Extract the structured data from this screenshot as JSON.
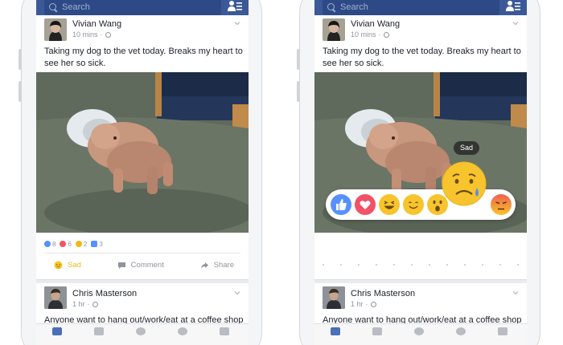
{
  "colors": {
    "facebook_blue": "#3b5998",
    "like_blue": "#5890ff",
    "love_red": "#f25268",
    "sad_yellow": "#f0ba15",
    "angry_orange": "#f0624d"
  },
  "search": {
    "placeholder": "Search"
  },
  "post": {
    "author": "Vivian Wang",
    "time": "10 mins",
    "separator": "·",
    "text": "Taking my dog to the vet today. Breaks my heart to see her so sick."
  },
  "reactions_summary": [
    {
      "icon": "like-icon",
      "count": "8"
    },
    {
      "icon": "love-icon",
      "count": "6"
    },
    {
      "icon": "sad-icon",
      "count": "2"
    },
    {
      "icon": "comment-icon",
      "count": "3"
    }
  ],
  "actions": {
    "sad_label": "Sad",
    "comment_label": "Comment",
    "share_label": "Share"
  },
  "next_post": {
    "author": "Chris Masterson",
    "time": "1 hr",
    "separator": "·",
    "text": "Anyone want to hang out/work/eat at a coffee shop"
  },
  "reaction_picker": {
    "tooltip": "Sad",
    "icons": [
      "like-icon",
      "love-icon",
      "haha-icon",
      "yay-icon",
      "wow-icon",
      "sad-icon",
      "angry-icon"
    ]
  }
}
